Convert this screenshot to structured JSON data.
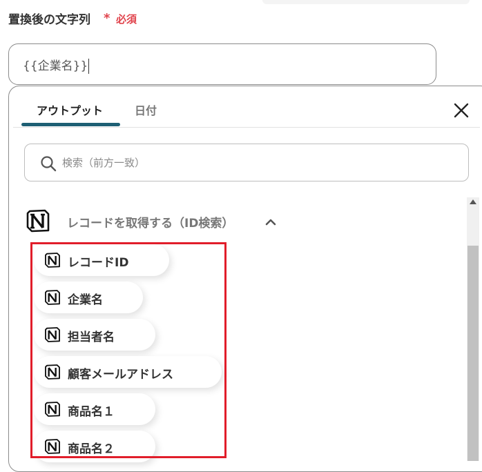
{
  "field": {
    "label": "置換後の文字列",
    "required_mark": "*",
    "required_text": "必須",
    "value": "{{企業名}}"
  },
  "popup": {
    "tabs": [
      {
        "label": "アウトプット",
        "active": true
      },
      {
        "label": "日付",
        "active": false
      }
    ],
    "close_icon": "close-icon",
    "search": {
      "placeholder": "検索（前方一致）",
      "value": ""
    },
    "group": {
      "title": "レコードを取得する（ID検索）",
      "expanded": true,
      "icon": "notion-logo-icon"
    },
    "items": [
      {
        "label": "レコードID"
      },
      {
        "label": "企業名"
      },
      {
        "label": "担当者名"
      },
      {
        "label": "顧客メールアドレス"
      },
      {
        "label": "商品名１"
      },
      {
        "label": "商品名２"
      }
    ]
  },
  "colors": {
    "accent": "#1e5f74",
    "required": "#e0434c",
    "highlight": "#e11d2a"
  }
}
